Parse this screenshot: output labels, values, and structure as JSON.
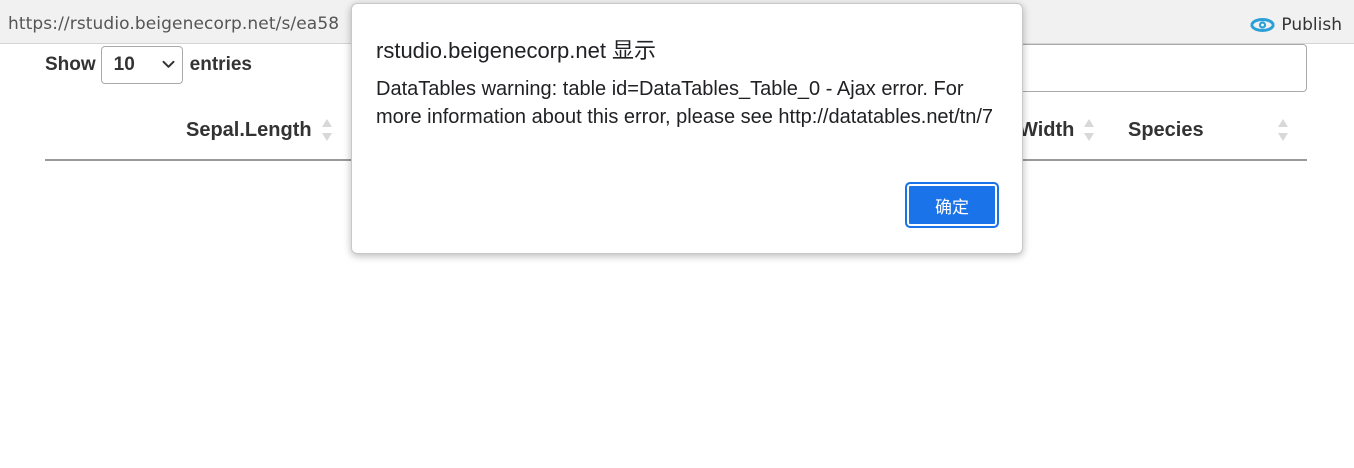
{
  "viewer_bar": {
    "url": "https://rstudio.beigenecorp.net/s/ea58",
    "publish_label": "Publish",
    "publish_icon": "publish-icon",
    "accent_color": "#2a9fd8"
  },
  "datatable": {
    "length_prefix": "Show",
    "length_value": "10",
    "length_suffix": "entries",
    "columns": [
      {
        "label": "Sepal.Length",
        "sort_icon": "sort-both-icon"
      },
      {
        "label": "Width",
        "sort_icon": "sort-both-icon"
      },
      {
        "label": "Species",
        "sort_icon": "sort-both-icon"
      }
    ]
  },
  "alert": {
    "title": "rstudio.beigenecorp.net 显示",
    "message": "DataTables warning: table id=DataTables_Table_0 - Ajax error. For more information about this error, please see http://datatables.net/tn/7",
    "ok_label": "确定",
    "button_color": "#1a73e8"
  }
}
